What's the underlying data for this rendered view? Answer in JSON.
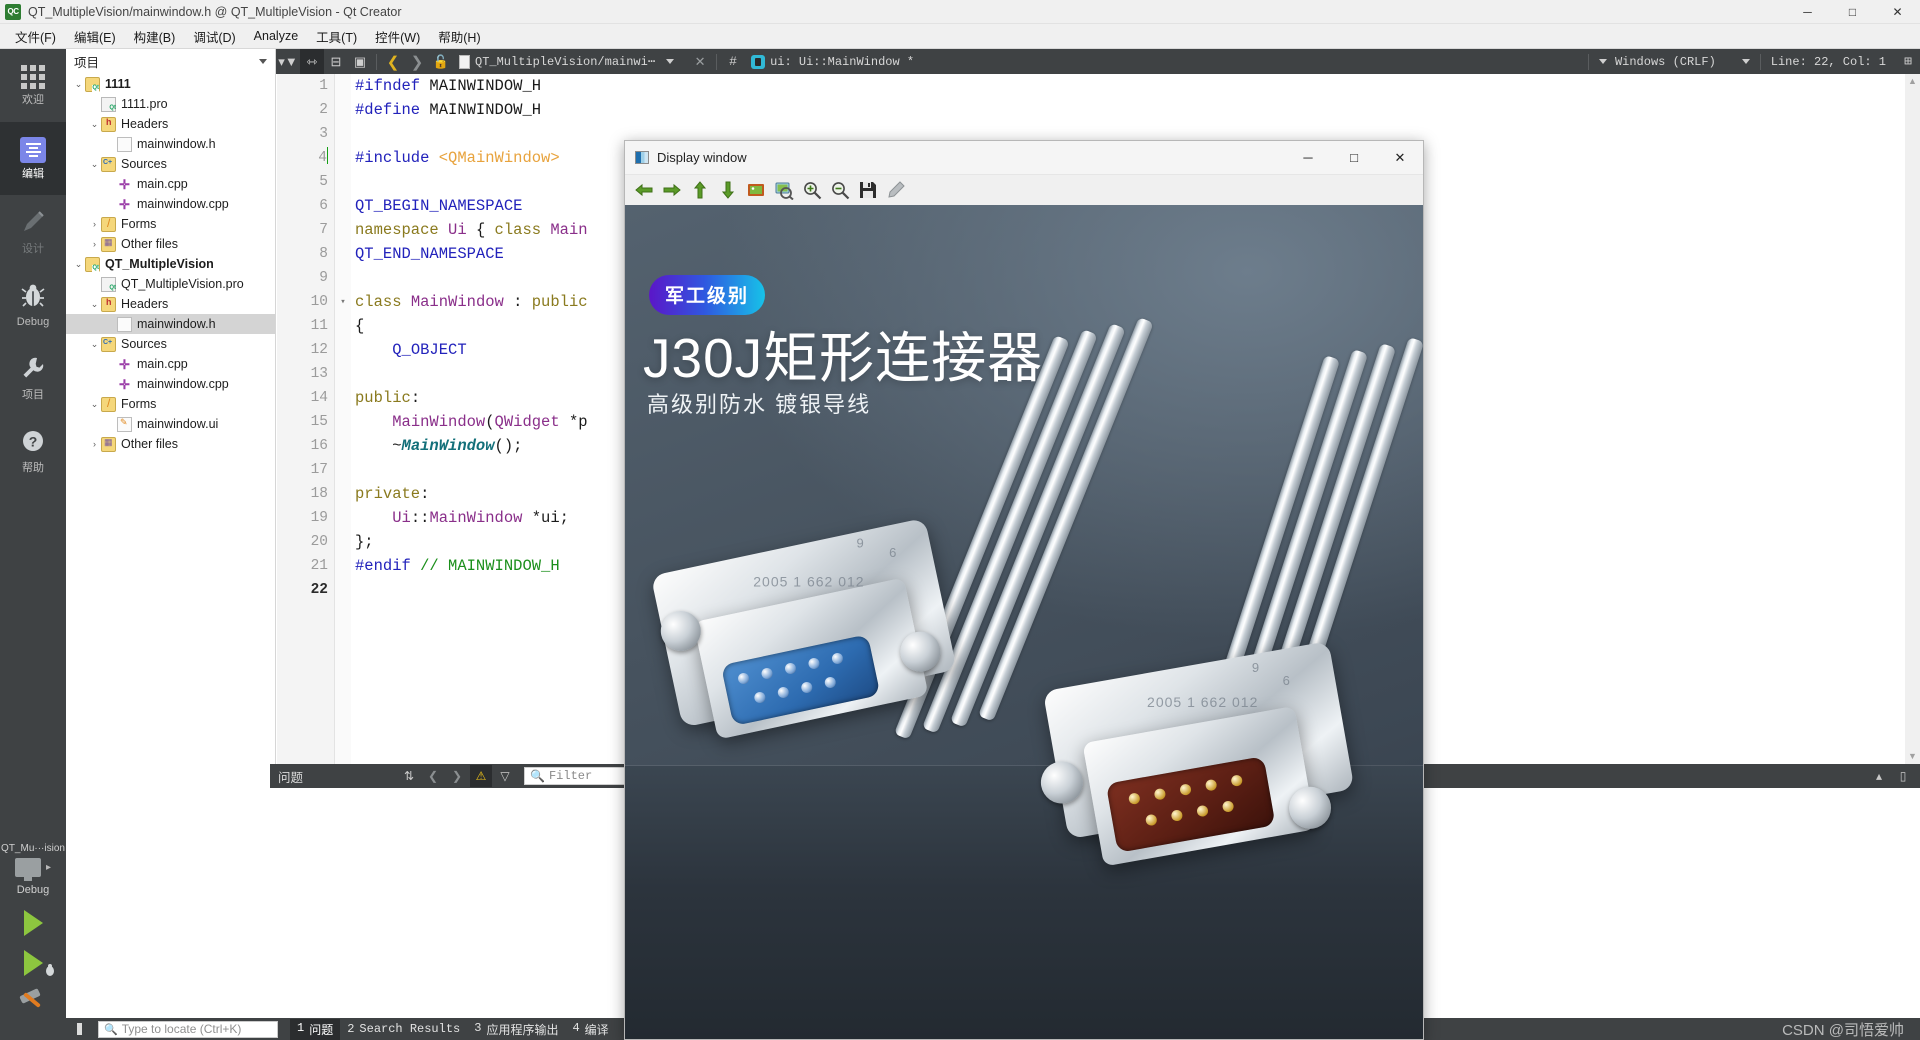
{
  "window": {
    "title": "QT_MultipleVision/mainwindow.h @ QT_MultipleVision - Qt Creator",
    "app_icon": "qt-creator-icon",
    "minimize": "─",
    "maximize": "□",
    "close": "✕",
    "icon_text": "QC"
  },
  "menu": [
    {
      "label": "文件(F)"
    },
    {
      "label": "编辑(E)"
    },
    {
      "label": "构建(B)"
    },
    {
      "label": "调试(D)"
    },
    {
      "label": "Analyze"
    },
    {
      "label": "工具(T)"
    },
    {
      "label": "控件(W)"
    },
    {
      "label": "帮助(H)"
    }
  ],
  "modes": [
    {
      "label": "欢迎",
      "icon": "grid-icon",
      "active": false,
      "dim": false
    },
    {
      "label": "编辑",
      "icon": "edit-document-icon",
      "active": true,
      "dim": false
    },
    {
      "label": "设计",
      "icon": "pencil-icon",
      "active": false,
      "dim": true
    },
    {
      "label": "Debug",
      "icon": "bug-icon",
      "active": false,
      "dim": false
    },
    {
      "label": "项目",
      "icon": "wrench-icon",
      "active": false,
      "dim": false
    },
    {
      "label": "帮助",
      "icon": "question-circle-icon",
      "active": false,
      "dim": false
    }
  ],
  "kit": {
    "name": "QT_Mu···ision",
    "build_config": "Debug",
    "run_label": "run-button",
    "debug_label": "run-debug-button",
    "build_label": "build-button"
  },
  "project_selector": {
    "label": "项目",
    "filter_icon": "filter-icon",
    "link_icon": "link-with-editor-icon",
    "split_icon": "split-icon",
    "more_icon": "more-icon"
  },
  "editor_bar": {
    "back_icon": "back-icon",
    "forward_icon": "forward-icon",
    "lock_icon": "unlocked-icon",
    "file_name": "QT_MultipleVision/mainwi⋯",
    "dropdown_icon": "chevron-down-icon",
    "close_icon": "close-icon",
    "hash": "#",
    "symbol": "ui: Ui::MainWindow *",
    "line_ending": "Windows (CRLF)",
    "cursor_position": "Line: 22, Col: 1",
    "split_icon_right": "split-editor-icon"
  },
  "tree": [
    {
      "indent": 0,
      "arrow": "⌄",
      "icon": "qt-project-icon",
      "label": "1111",
      "bold": true,
      "selected": false
    },
    {
      "indent": 1,
      "arrow": "",
      "icon": "pro-file-icon",
      "label": "1111.pro",
      "bold": false,
      "selected": false
    },
    {
      "indent": 1,
      "arrow": "⌄",
      "icon": "headers-folder-icon",
      "label": "Headers",
      "bold": false,
      "selected": false
    },
    {
      "indent": 2,
      "arrow": "",
      "icon": "header-file-icon",
      "label": "mainwindow.h",
      "bold": false,
      "selected": false
    },
    {
      "indent": 1,
      "arrow": "⌄",
      "icon": "sources-folder-icon",
      "label": "Sources",
      "bold": false,
      "selected": false
    },
    {
      "indent": 2,
      "arrow": "",
      "icon": "cpp-file-icon",
      "label": "main.cpp",
      "bold": false,
      "selected": false
    },
    {
      "indent": 2,
      "arrow": "",
      "icon": "cpp-file-icon",
      "label": "mainwindow.cpp",
      "bold": false,
      "selected": false
    },
    {
      "indent": 1,
      "arrow": "›",
      "icon": "forms-folder-icon",
      "label": "Forms",
      "bold": false,
      "selected": false
    },
    {
      "indent": 1,
      "arrow": "›",
      "icon": "other-files-folder-icon",
      "label": "Other files",
      "bold": false,
      "selected": false
    },
    {
      "indent": 0,
      "arrow": "⌄",
      "icon": "qt-project-icon",
      "label": "QT_MultipleVision",
      "bold": true,
      "selected": false
    },
    {
      "indent": 1,
      "arrow": "",
      "icon": "pro-file-icon",
      "label": "QT_MultipleVision.pro",
      "bold": false,
      "selected": false
    },
    {
      "indent": 1,
      "arrow": "⌄",
      "icon": "headers-folder-icon",
      "label": "Headers",
      "bold": false,
      "selected": false
    },
    {
      "indent": 2,
      "arrow": "",
      "icon": "header-file-icon",
      "label": "mainwindow.h",
      "bold": false,
      "selected": true
    },
    {
      "indent": 1,
      "arrow": "⌄",
      "icon": "sources-folder-icon",
      "label": "Sources",
      "bold": false,
      "selected": false
    },
    {
      "indent": 2,
      "arrow": "",
      "icon": "cpp-file-icon",
      "label": "main.cpp",
      "bold": false,
      "selected": false
    },
    {
      "indent": 2,
      "arrow": "",
      "icon": "cpp-file-icon",
      "label": "mainwindow.cpp",
      "bold": false,
      "selected": false
    },
    {
      "indent": 1,
      "arrow": "⌄",
      "icon": "forms-folder-icon",
      "label": "Forms",
      "bold": false,
      "selected": false
    },
    {
      "indent": 2,
      "arrow": "",
      "icon": "ui-file-icon",
      "label": "mainwindow.ui",
      "bold": false,
      "selected": false
    },
    {
      "indent": 1,
      "arrow": "›",
      "icon": "other-files-folder-icon",
      "label": "Other files",
      "bold": false,
      "selected": false
    }
  ],
  "code": {
    "current_line": 4,
    "bold_line": 22,
    "lines": [
      {
        "n": 1,
        "fold": "",
        "html": "<span class='k-pre'>#ifndef</span> MAINWINDOW_H"
      },
      {
        "n": 2,
        "fold": "",
        "html": "<span class='k-pre'>#define</span> MAINWINDOW_H"
      },
      {
        "n": 3,
        "fold": "",
        "html": ""
      },
      {
        "n": 4,
        "fold": "",
        "html": "<span class='k-pre'>#include</span> <span class='k-inc'>&lt;QMainWindow&gt;</span>"
      },
      {
        "n": 5,
        "fold": "",
        "html": ""
      },
      {
        "n": 6,
        "fold": "",
        "html": "<span class='k-macro'>QT_BEGIN_NAMESPACE</span>"
      },
      {
        "n": 7,
        "fold": "",
        "html": "<span class='k-kw'>namespace</span> <span class='k-type'>Ui</span> { <span class='k-kw'>class</span> <span class='k-type'>Main</span>"
      },
      {
        "n": 8,
        "fold": "",
        "html": "<span class='k-macro'>QT_END_NAMESPACE</span>"
      },
      {
        "n": 9,
        "fold": "",
        "html": ""
      },
      {
        "n": 10,
        "fold": "▾",
        "html": "<span class='k-kw'>class</span> <span class='k-type'>MainWindow</span> : <span class='k-kw'>public</span>"
      },
      {
        "n": 11,
        "fold": "",
        "html": "{"
      },
      {
        "n": 12,
        "fold": "",
        "html": "    <span class='k-macro'>Q_OBJECT</span>"
      },
      {
        "n": 13,
        "fold": "",
        "html": ""
      },
      {
        "n": 14,
        "fold": "",
        "html": "<span class='k-kw'>public</span>:"
      },
      {
        "n": 15,
        "fold": "",
        "html": "    <span class='k-type'>MainWindow</span>(<span class='k-type'>QWidget</span> *p"
      },
      {
        "n": 16,
        "fold": "",
        "html": "    ~<span class='k-fn'>MainWindow</span>();"
      },
      {
        "n": 17,
        "fold": "",
        "html": ""
      },
      {
        "n": 18,
        "fold": "",
        "html": "<span class='k-kw'>private</span>:"
      },
      {
        "n": 19,
        "fold": "",
        "html": "    <span class='k-type'>Ui</span>::<span class='k-type'>MainWindow</span> *ui;"
      },
      {
        "n": 20,
        "fold": "",
        "html": "};"
      },
      {
        "n": 21,
        "fold": "",
        "html": "<span class='k-pre'>#endif</span> <span class='k-cmt'>// MAINWINDOW_H</span>"
      },
      {
        "n": 22,
        "fold": "",
        "html": ""
      }
    ]
  },
  "issues_pane": {
    "title": "问题",
    "sort_icon": "sort-icon",
    "prev_icon": "chevron-left-icon",
    "next_icon": "chevron-right-icon",
    "warning_icon": "warning-icon",
    "filter_icon": "filter-icon",
    "search_icon": "search-icon",
    "filter_placeholder": "Filter",
    "collapse_icon": "chevron-up-icon",
    "maximize_icon": "maximize-pane-icon"
  },
  "status_bar": {
    "sidebar_toggle_icon": "toggle-sidebar-icon",
    "locate_icon": "search-icon",
    "locate_placeholder": "Type to locate (Ctrl+K)",
    "items": [
      {
        "num": "1",
        "label": "问题",
        "active": true
      },
      {
        "num": "2",
        "label": "Search Results",
        "active": false
      },
      {
        "num": "3",
        "label": "应用程序输出",
        "active": false
      },
      {
        "num": "4",
        "label": "编译",
        "active": false
      }
    ],
    "watermark": "CSDN @司悟爱帅"
  },
  "display_window": {
    "title": "Display window",
    "icon": "image-icon",
    "minimize": "─",
    "maximize": "□",
    "close": "✕",
    "toolbar": [
      {
        "name": "pan-left-icon",
        "glyph": "⬅"
      },
      {
        "name": "pan-right-icon",
        "glyph": "➡"
      },
      {
        "name": "pan-up-icon",
        "glyph": "⬆"
      },
      {
        "name": "pan-down-icon",
        "glyph": "⬇"
      },
      {
        "name": "zoom-fit-icon",
        "glyph": "▣"
      },
      {
        "name": "zoom-actual-size-icon",
        "glyph": "▣"
      },
      {
        "name": "zoom-in-icon",
        "glyph": "⊕"
      },
      {
        "name": "zoom-out-icon",
        "glyph": "⊖"
      },
      {
        "name": "save-icon",
        "glyph": "💾"
      },
      {
        "name": "properties-icon",
        "glyph": "✐"
      }
    ],
    "image": {
      "badge": "军工级别",
      "headline": "J30J矩形连接器",
      "subline": "高级别防水 镀银导线",
      "engraving_1": "2005 1 662 012",
      "engraving_2": "9",
      "engraving_3": "6",
      "bg_color": "#48545f",
      "badge_gradient_from": "#5b16c8",
      "badge_gradient_to": "#17c2e8"
    }
  }
}
